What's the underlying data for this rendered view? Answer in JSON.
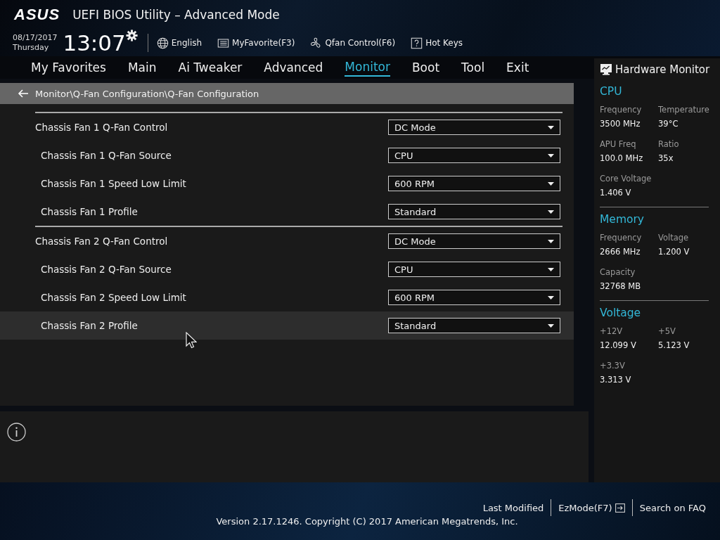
{
  "header": {
    "logo": "ASUS",
    "title": "UEFI BIOS Utility – Advanced Mode",
    "date": "08/17/2017",
    "day": "Thursday",
    "time": "13:07",
    "tools": [
      {
        "kind": "globe",
        "label": "English"
      },
      {
        "kind": "favorite",
        "label": "MyFavorite(F3)"
      },
      {
        "kind": "fan",
        "label": "Qfan Control(F6)"
      },
      {
        "kind": "help",
        "label": "Hot Keys"
      }
    ]
  },
  "tabs": [
    {
      "label": "My Favorites",
      "selected": false
    },
    {
      "label": "Main",
      "selected": false
    },
    {
      "label": "Ai Tweaker",
      "selected": false
    },
    {
      "label": "Advanced",
      "selected": false
    },
    {
      "label": "Monitor",
      "selected": true
    },
    {
      "label": "Boot",
      "selected": false
    },
    {
      "label": "Tool",
      "selected": false
    },
    {
      "label": "Exit",
      "selected": false
    }
  ],
  "breadcrumb": "Monitor\\Q-Fan Configuration\\Q-Fan Configuration",
  "settings": [
    {
      "label": "Chassis Fan 1 Q-Fan Control",
      "value": "DC Mode",
      "selected": false,
      "children": [
        {
          "label": "Chassis Fan 1 Q-Fan Source",
          "value": "CPU",
          "selected": false
        },
        {
          "label": "Chassis Fan 1 Speed Low Limit",
          "value": "600 RPM",
          "selected": false
        },
        {
          "label": "Chassis Fan 1 Profile",
          "value": "Standard",
          "selected": false
        }
      ]
    },
    {
      "label": "Chassis Fan 2 Q-Fan Control",
      "value": "DC Mode",
      "selected": false,
      "children": [
        {
          "label": "Chassis Fan 2 Q-Fan Source",
          "value": "CPU",
          "selected": false
        },
        {
          "label": "Chassis Fan 2 Speed Low Limit",
          "value": "600 RPM",
          "selected": false
        },
        {
          "label": "Chassis Fan 2 Profile",
          "value": "Standard",
          "selected": true
        }
      ]
    }
  ],
  "hardware_monitor": {
    "title": "Hardware Monitor",
    "sections": [
      {
        "title": "CPU",
        "items": [
          {
            "label": "Frequency",
            "value": "3500 MHz"
          },
          {
            "label": "Temperature",
            "value": "39°C"
          },
          {
            "label": "APU Freq",
            "value": "100.0 MHz"
          },
          {
            "label": "Ratio",
            "value": "35x"
          },
          {
            "label": "Core Voltage",
            "value": "1.406 V"
          }
        ]
      },
      {
        "title": "Memory",
        "items": [
          {
            "label": "Frequency",
            "value": "2666 MHz"
          },
          {
            "label": "Voltage",
            "value": "1.200 V"
          },
          {
            "label": "Capacity",
            "value": "32768 MB"
          }
        ]
      },
      {
        "title": "Voltage",
        "items": [
          {
            "label": "+12V",
            "value": "12.099 V"
          },
          {
            "label": "+5V",
            "value": "5.123 V"
          },
          {
            "label": "+3.3V",
            "value": "3.313 V"
          }
        ]
      }
    ]
  },
  "footer": {
    "links": [
      {
        "kind": "text",
        "label": "Last Modified"
      },
      {
        "kind": "exit",
        "label": "EzMode(F7)"
      },
      {
        "kind": "text",
        "label": "Search on FAQ"
      }
    ],
    "version": "Version 2.17.1246. Copyright (C) 2017 American Megatrends, Inc."
  }
}
